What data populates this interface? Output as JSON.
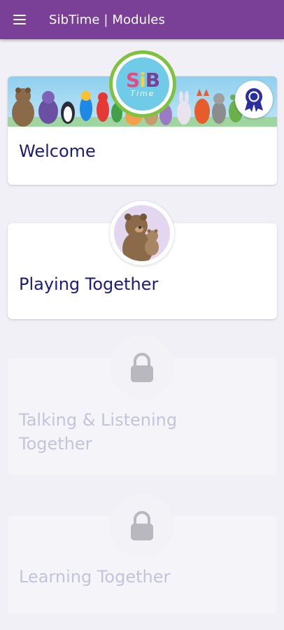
{
  "app_bar": {
    "title": "SibTime | Modules",
    "menu_icon": "hamburger-menu-icon",
    "color": "#7a3f97"
  },
  "logo": {
    "letters": [
      "S",
      "i",
      "B"
    ],
    "sub": "Time",
    "ring_color": "#7ec23f"
  },
  "modules": [
    {
      "title": "Welcome",
      "locked": false,
      "badge_icon": "award-ribbon-icon"
    },
    {
      "title": "Playing Together",
      "locked": false,
      "icon": "bear-family-icon"
    },
    {
      "title": "Talking & Listening Together",
      "locked": true,
      "icon": "lock-icon"
    },
    {
      "title": "Learning Together",
      "locked": true,
      "icon": "lock-icon"
    }
  ],
  "colors": {
    "title_text": "#1b1b7a",
    "locked_text": "#c4c3dc",
    "background": "#f1f0f6"
  }
}
